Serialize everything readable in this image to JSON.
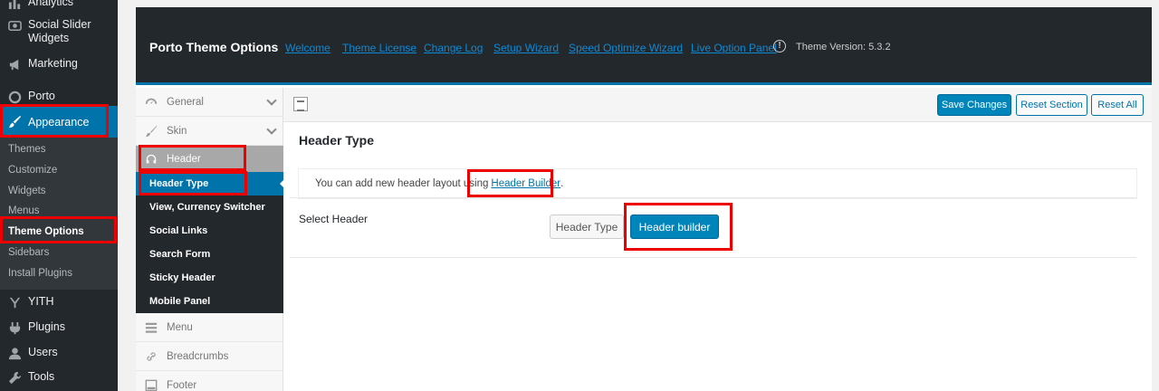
{
  "wp_sidebar": {
    "items": [
      {
        "label": "Analytics",
        "icon": "chart-bar-icon"
      },
      {
        "label": "Social Slider Widgets",
        "icon": "slider-icon"
      },
      {
        "label": "Marketing",
        "icon": "megaphone-icon"
      },
      {
        "label": "Porto",
        "icon": "circle-icon"
      },
      {
        "label": "Appearance",
        "icon": "paintbrush-icon"
      },
      {
        "label": "YITH",
        "icon": "yith-icon"
      },
      {
        "label": "Plugins",
        "icon": "plug-icon"
      },
      {
        "label": "Users",
        "icon": "user-icon"
      },
      {
        "label": "Tools",
        "icon": "wrench-icon"
      }
    ],
    "submenu": [
      "Themes",
      "Customize",
      "Widgets",
      "Menus",
      "Theme Options",
      "Sidebars",
      "Install Plugins"
    ]
  },
  "header": {
    "title": "Porto Theme Options",
    "links": [
      "Welcome",
      "Theme License",
      "Change Log",
      "Setup Wizard",
      "Speed Optimize Wizard",
      "Live Option Panel"
    ],
    "version": "Theme Version: 5.3.2"
  },
  "options_nav": {
    "top_items": [
      {
        "label": "General",
        "icon": "dashboard-icon"
      },
      {
        "label": "Skin",
        "icon": "brush-icon"
      },
      {
        "label": "Header",
        "icon": "headphones-icon"
      }
    ],
    "header_sub": [
      "Header Type",
      "View, Currency Switcher",
      "Social Links",
      "Search Form",
      "Sticky Header",
      "Mobile Panel"
    ],
    "bottom_items": [
      {
        "label": "Menu",
        "icon": "menu-icon"
      },
      {
        "label": "Breadcrumbs",
        "icon": "link-icon"
      },
      {
        "label": "Footer",
        "icon": "footer-icon"
      }
    ]
  },
  "toolbar": {
    "save": "Save Changes",
    "reset_section": "Reset Section",
    "reset_all": "Reset All"
  },
  "content": {
    "section_title": "Header Type",
    "notice_text": "You can add new header layout using",
    "notice_link": "Header Builder",
    "notice_end": ".",
    "select_label": "Select Header",
    "options": [
      "Header Type",
      "Header builder"
    ],
    "selected": "Header builder"
  },
  "colors": {
    "wp_dark": "#23282d",
    "accent": "#0073aa",
    "highlight": "#ee0000"
  }
}
